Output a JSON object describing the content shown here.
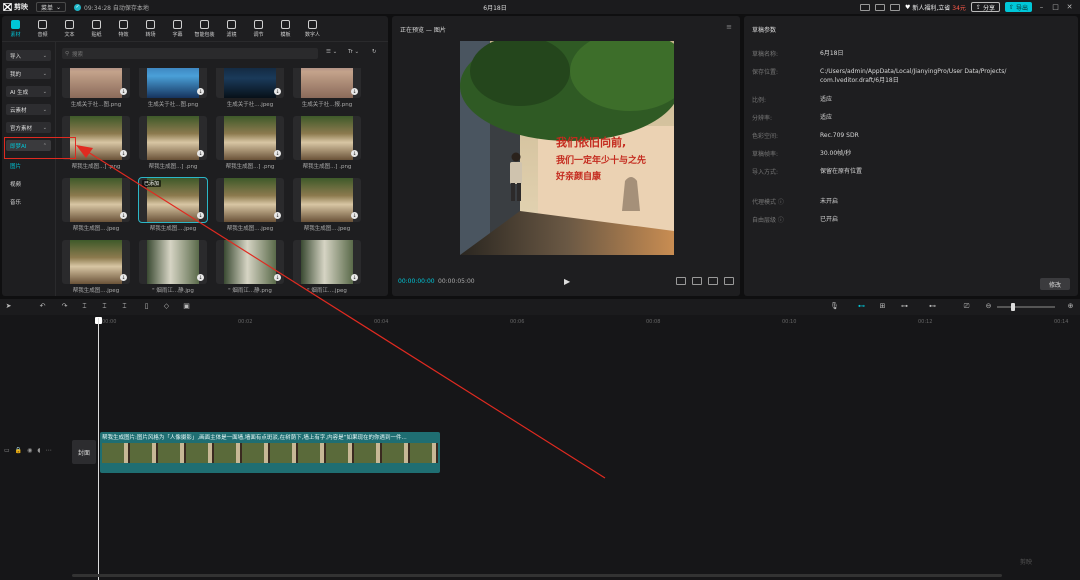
{
  "topbar": {
    "app_name": "剪映",
    "menu_label": "菜单",
    "save_status": "09:34:28 自动保存本地",
    "project_title": "6月18日",
    "promo_prefix": "新人福利,立省",
    "promo_amount": "34元",
    "share_label": "分享",
    "export_label": "导出"
  },
  "tools": [
    {
      "label": "素材",
      "icon": "media-icon"
    },
    {
      "label": "音频",
      "icon": "audio-icon"
    },
    {
      "label": "文本",
      "icon": "text-icon"
    },
    {
      "label": "贴纸",
      "icon": "sticker-icon"
    },
    {
      "label": "特效",
      "icon": "effects-icon"
    },
    {
      "label": "转场",
      "icon": "transition-icon"
    },
    {
      "label": "字幕",
      "icon": "subtitle-icon"
    },
    {
      "label": "智能包装",
      "icon": "smart-package-icon"
    },
    {
      "label": "滤镜",
      "icon": "filter-icon"
    },
    {
      "label": "调节",
      "icon": "adjust-icon"
    },
    {
      "label": "模板",
      "icon": "template-icon"
    },
    {
      "label": "数字人",
      "icon": "digital-human-icon"
    }
  ],
  "categories": [
    "导入",
    "我的",
    "AI 生成",
    "云素材",
    "官方素材",
    "即梦AI"
  ],
  "subcategories": [
    "图片",
    "视频",
    "音乐"
  ],
  "search": {
    "placeholder": "搜索"
  },
  "filters": {
    "sort": "☰",
    "type": "Tr"
  },
  "media_items": [
    {
      "caption": "生成关于社...图.png",
      "style": "poster"
    },
    {
      "caption": "生成关于社...图.png",
      "style": "blue"
    },
    {
      "caption": "生成关于社....jpeg",
      "style": "dark"
    },
    {
      "caption": "生成关于社...报.png",
      "style": "poster"
    },
    {
      "caption": "帮我生成图...] .png",
      "style": "wall"
    },
    {
      "caption": "帮我生成图...] .png",
      "style": "wall"
    },
    {
      "caption": "帮我生成图...] .png",
      "style": "wall"
    },
    {
      "caption": "帮我生成图...] .png",
      "style": "wall"
    },
    {
      "caption": "帮我生成图....jpeg",
      "style": "wall"
    },
    {
      "caption": "帮我生成图....jpeg",
      "style": "wall",
      "selected": true,
      "badge": "已添加"
    },
    {
      "caption": "帮我生成图....jpeg",
      "style": "wall"
    },
    {
      "caption": "帮我生成图....jpeg",
      "style": "wall"
    },
    {
      "caption": "帮我生成图....jpeg",
      "style": "wall"
    },
    {
      "caption": "\" 烟雨江...静.jpg",
      "style": "alley"
    },
    {
      "caption": "\" 烟雨江...静.png",
      "style": "alley"
    },
    {
      "caption": "\" 烟雨江....jpeg",
      "style": "alley"
    }
  ],
  "preview": {
    "title": "正在预览 — 图片",
    "time_current": "00:00:00:00",
    "time_total": "00:00:05:00",
    "wall_text_1": "我们依旧向前,",
    "wall_text_2": "我们一定年少十与之先",
    "wall_text_3": "好亲颜自康"
  },
  "draft": {
    "title": "草稿参数",
    "rows": [
      {
        "key": "草稿名称:",
        "value": "6月18日"
      },
      {
        "key": "保存位置:",
        "value": "C:/Users/admin/AppData/Local/JianyingPro/User Data/Projects/",
        "value2": "com.lveditor.draft/6月18日"
      },
      {
        "key": "比例:",
        "value": "适应"
      },
      {
        "key": "分辨率:",
        "value": "适应"
      },
      {
        "key": "色彩空间:",
        "value": "Rec.709 SDR"
      },
      {
        "key": "草稿帧率:",
        "value": "30.00帧/秒"
      },
      {
        "key": "导入方式:",
        "value": "保留在原有位置"
      },
      {
        "key": "代理模式 ⓘ",
        "value": "未开启"
      },
      {
        "key": "自由层级 ⓘ",
        "value": "已开启"
      }
    ],
    "modify_label": "修改"
  },
  "timeline": {
    "ruler_labels": [
      "00:00",
      "00:02",
      "00:04",
      "00:06",
      "00:08",
      "00:10",
      "00:12",
      "00:14"
    ],
    "cover_label": "封面",
    "clip_label": "帮我生成图片:图片风格为「人像摄影」,画面主体是一面墙,墙面有点斑驳,在树荫下,墙上有字,内容是“如果现在的你遇到一件...",
    "watermark": "剪映"
  },
  "colors": {
    "accent": "#00c7d8",
    "annotation": "#e02a20"
  }
}
